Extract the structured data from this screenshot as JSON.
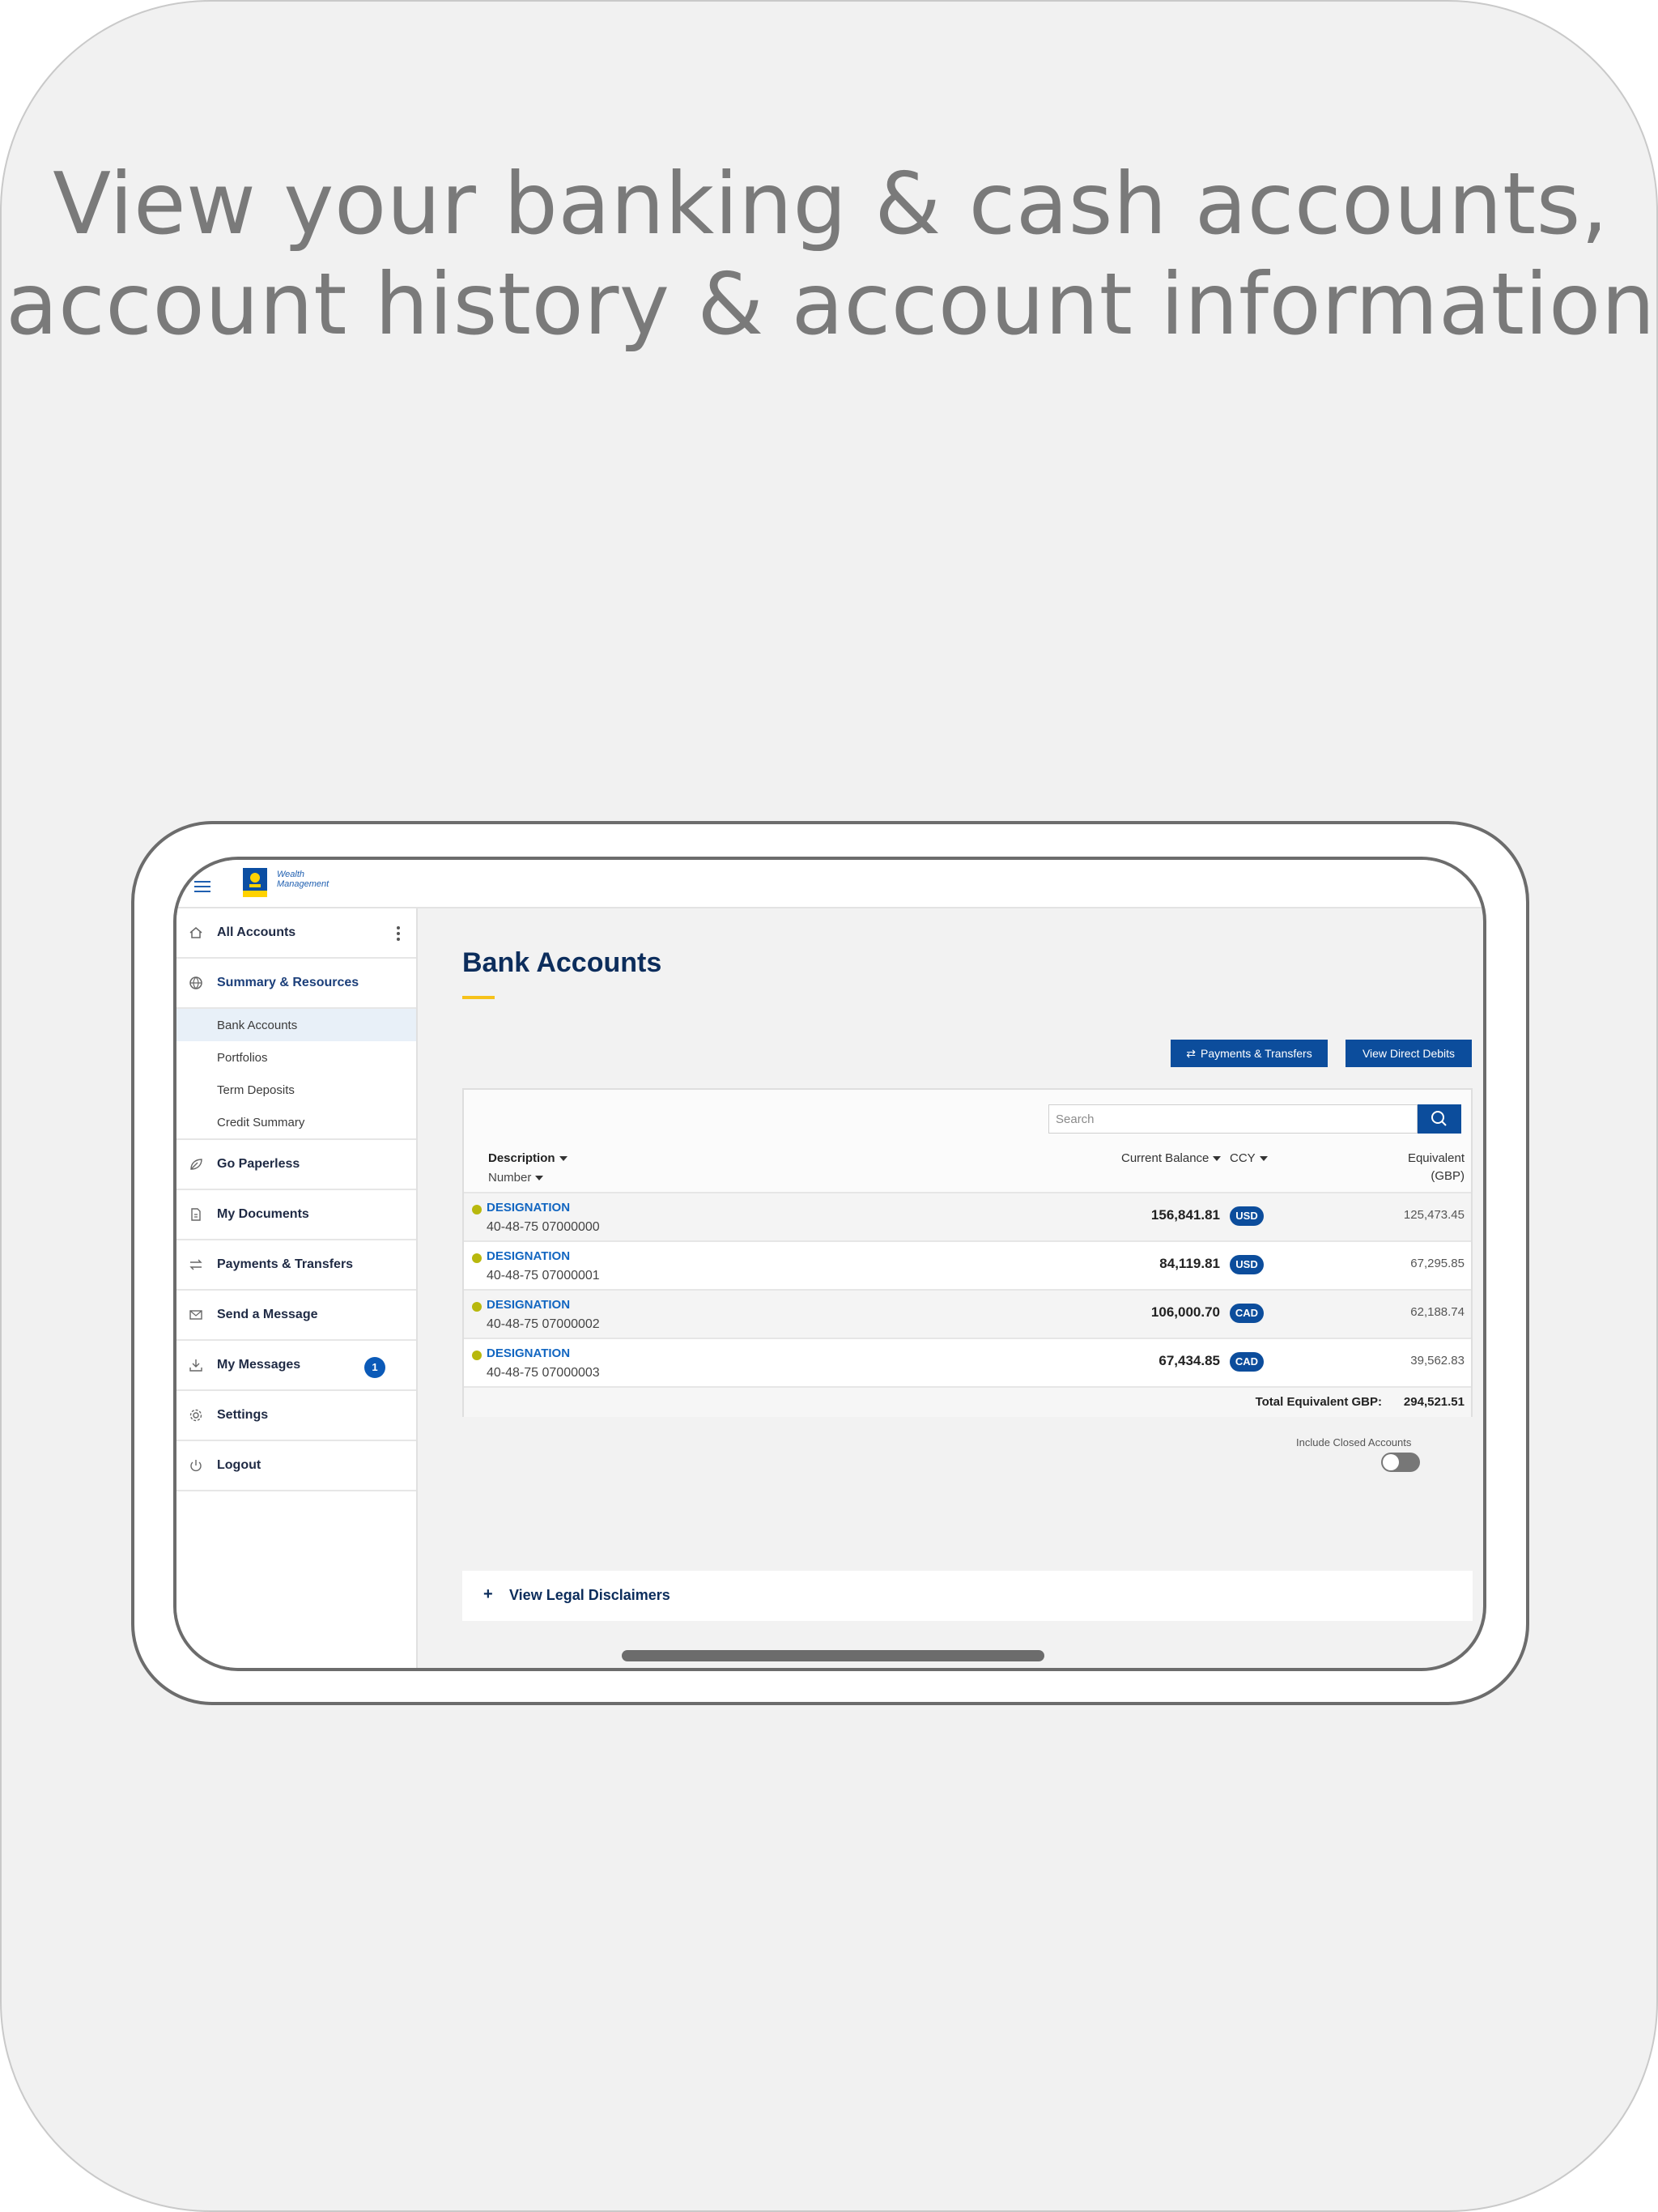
{
  "headline": {
    "line1": "View your banking & cash accounts,",
    "line2": "account history & account information"
  },
  "header": {
    "logo_text_1": "Wealth",
    "logo_text_2": "Management",
    "logo_abbrev": "RBC"
  },
  "sidebar": {
    "all_accounts": "All Accounts",
    "summary": "Summary & Resources",
    "sub_items": [
      "Bank Accounts",
      "Portfolios",
      "Term Deposits",
      "Credit Summary"
    ],
    "go_paperless": "Go Paperless",
    "my_documents": "My Documents",
    "payments": "Payments & Transfers",
    "send_message": "Send a Message",
    "my_messages": "My Messages",
    "messages_count": "1",
    "settings": "Settings",
    "logout": "Logout"
  },
  "main": {
    "title": "Bank Accounts",
    "btn_payments": "Payments & Transfers",
    "btn_direct_debits": "View Direct Debits",
    "search_placeholder": "Search",
    "col_description": "Description",
    "col_number": "Number",
    "col_balance": "Current Balance",
    "col_ccy": "CCY",
    "col_equiv_1": "Equivalent",
    "col_equiv_2": "(GBP)",
    "rows": [
      {
        "designation": "DESIGNATION",
        "number": "40-48-75  07000000",
        "balance": "156,841.81",
        "ccy": "USD",
        "equivalent": "125,473.45"
      },
      {
        "designation": "DESIGNATION",
        "number": "40-48-75  07000001",
        "balance": "84,119.81",
        "ccy": "USD",
        "equivalent": "67,295.85"
      },
      {
        "designation": "DESIGNATION",
        "number": "40-48-75  07000002",
        "balance": "106,000.70",
        "ccy": "CAD",
        "equivalent": "62,188.74"
      },
      {
        "designation": "DESIGNATION",
        "number": "40-48-75  07000003",
        "balance": "67,434.85",
        "ccy": "CAD",
        "equivalent": "39,562.83"
      }
    ],
    "total_label": "Total Equivalent GBP:",
    "total_value": "294,521.51",
    "include_closed": "Include Closed Accounts",
    "legal_plus": "+",
    "legal_text": "View Legal Disclaimers"
  },
  "colors": {
    "brand_blue": "#0c4d9c",
    "title_navy": "#0c2d5c",
    "accent_yellow": "#f6c21b",
    "status_dot": "#b8b80d"
  }
}
